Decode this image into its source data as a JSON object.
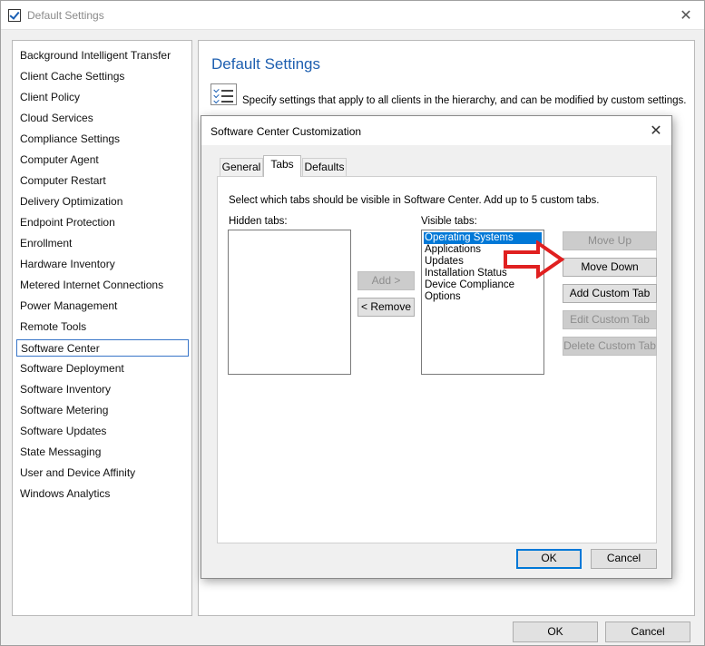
{
  "window": {
    "title": "Default Settings"
  },
  "nav": {
    "items": [
      {
        "label": "Background Intelligent Transfer"
      },
      {
        "label": "Client Cache Settings"
      },
      {
        "label": "Client Policy"
      },
      {
        "label": "Cloud Services"
      },
      {
        "label": "Compliance Settings"
      },
      {
        "label": "Computer Agent"
      },
      {
        "label": "Computer Restart"
      },
      {
        "label": "Delivery Optimization"
      },
      {
        "label": "Endpoint Protection"
      },
      {
        "label": "Enrollment"
      },
      {
        "label": "Hardware Inventory"
      },
      {
        "label": "Metered Internet Connections"
      },
      {
        "label": "Power Management"
      },
      {
        "label": "Remote Tools"
      },
      {
        "label": "Software Center"
      },
      {
        "label": "Software Deployment"
      },
      {
        "label": "Software Inventory"
      },
      {
        "label": "Software Metering"
      },
      {
        "label": "Software Updates"
      },
      {
        "label": "State Messaging"
      },
      {
        "label": "User and Device Affinity"
      },
      {
        "label": "Windows Analytics"
      }
    ],
    "selected": "Software Center"
  },
  "content": {
    "heading": "Default Settings",
    "description": "Specify settings that apply to all clients in the hierarchy, and can be modified by custom settings."
  },
  "footer": {
    "ok_label": "OK",
    "cancel_label": "Cancel"
  },
  "dialog": {
    "title": "Software Center Customization",
    "tabs": [
      {
        "label": "General"
      },
      {
        "label": "Tabs"
      },
      {
        "label": "Defaults"
      }
    ],
    "active_tab": "Tabs",
    "instruction": "Select which tabs should be visible in Software Center. Add up to 5 custom tabs.",
    "hidden_label": "Hidden tabs:",
    "visible_label": "Visible tabs:",
    "hidden_tabs": [],
    "visible_tabs": [
      {
        "label": "Operating Systems"
      },
      {
        "label": "Applications"
      },
      {
        "label": "Updates"
      },
      {
        "label": "Installation Status"
      },
      {
        "label": "Device Compliance"
      },
      {
        "label": "Options"
      }
    ],
    "selected_visible": "Operating Systems",
    "add_label": "Add >",
    "remove_label": "< Remove",
    "move_up_label": "Move Up",
    "move_down_label": "Move Down",
    "add_custom_label": "Add Custom Tab",
    "edit_custom_label": "Edit Custom Tab",
    "delete_custom_label": "Delete Custom Tab",
    "ok_label": "OK",
    "cancel_label": "Cancel"
  },
  "colors": {
    "accent": "#0078d7",
    "heading": "#1e5fb0",
    "arrow": "#e02020"
  }
}
